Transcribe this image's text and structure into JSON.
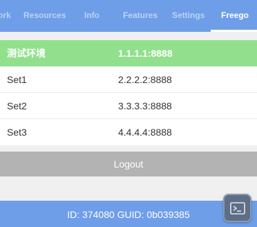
{
  "tabs": [
    {
      "label": "ork",
      "active": false
    },
    {
      "label": "Resources",
      "active": false
    },
    {
      "label": "Info",
      "active": false
    },
    {
      "label": "Features",
      "active": false
    },
    {
      "label": "Settings",
      "active": false
    },
    {
      "label": "Freego",
      "active": true
    }
  ],
  "servers": [
    {
      "name": "测试环境",
      "address": "1.1.1.1:8888",
      "selected": true
    },
    {
      "name": "Set1",
      "address": "2.2.2.2:8888",
      "selected": false
    },
    {
      "name": "Set2",
      "address": "3.3.3.3:8888",
      "selected": false
    },
    {
      "name": "Set3",
      "address": "4.4.4.4:8888",
      "selected": false
    }
  ],
  "logout_label": "Logout",
  "footer": {
    "text": "ID: 374080 GUID: 0b039385"
  },
  "floating_button": {
    "icon": "terminal-icon"
  },
  "colors": {
    "accent": "#6f9ee8",
    "selected_row": "#92e08e",
    "logout": "#b3b3b3"
  }
}
